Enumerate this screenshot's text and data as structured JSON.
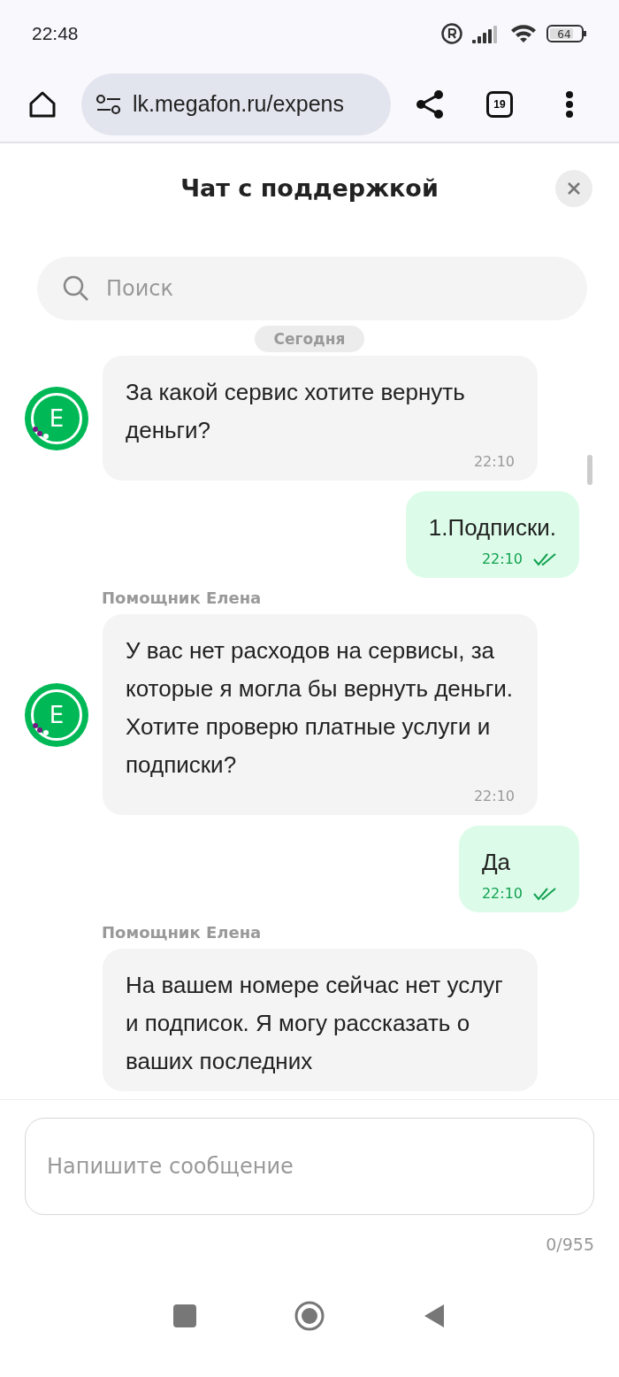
{
  "status_bar": {
    "time": "22:48",
    "battery": "64"
  },
  "browser": {
    "url": "lk.megafon.ru/expens",
    "tabs_count": "19"
  },
  "chat": {
    "title": "Чат с поддержкой",
    "search": {
      "placeholder": "Поиск"
    },
    "date_label": "Сегодня",
    "messages": [
      {
        "kind": "incoming",
        "avatar": "E",
        "text": "За какой сервис хотите вернуть деньги?",
        "time": "22:10"
      },
      {
        "kind": "outgoing",
        "text": "1.Подписки.",
        "time": "22:10",
        "read": true
      },
      {
        "kind": "incoming",
        "sender": "Помощник Елена",
        "avatar": "E",
        "text": "У вас нет расходов на сервисы, за которые я могла бы вернуть деньги. Хотите проверю платные услуги и подписки?",
        "time": "22:10"
      },
      {
        "kind": "outgoing",
        "text": "Да",
        "time": "22:10",
        "read": true
      },
      {
        "kind": "incoming",
        "sender": "Помощник Елена",
        "text": "На вашем номере сейчас нет услуг и подписок. Я могу рассказать о ваших последних"
      }
    ],
    "composer": {
      "placeholder": "Напишите сообщение",
      "counter": "0/955"
    }
  }
}
